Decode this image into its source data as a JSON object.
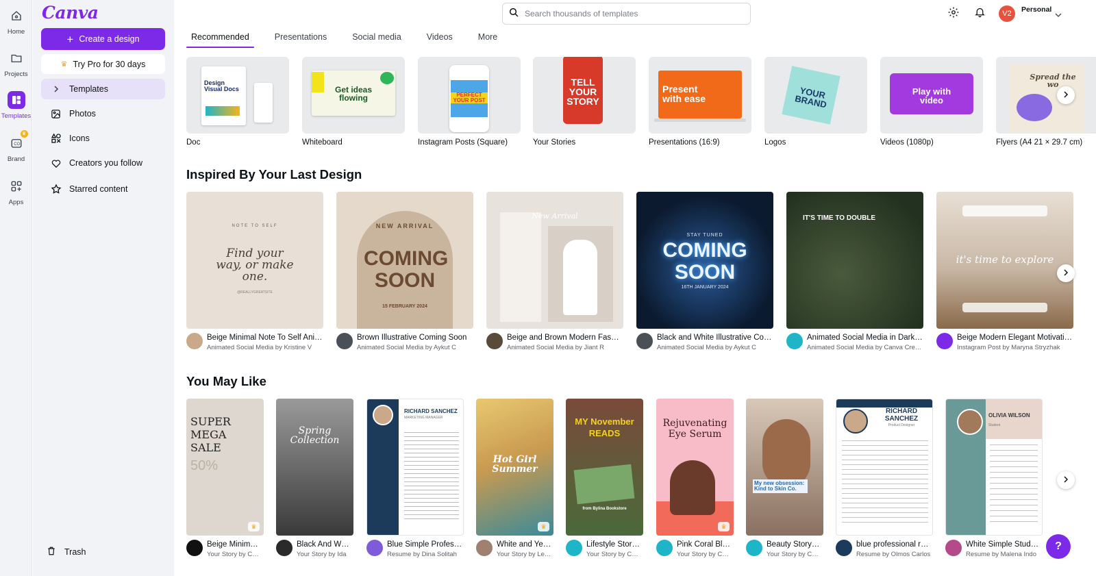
{
  "app": {
    "logo": "Canva"
  },
  "rail": [
    {
      "label": "Home",
      "icon": "home-icon"
    },
    {
      "label": "Projects",
      "icon": "folder-icon"
    },
    {
      "label": "Templates",
      "icon": "templates-icon"
    },
    {
      "label": "Brand",
      "icon": "brand-icon"
    },
    {
      "label": "Apps",
      "icon": "apps-icon"
    }
  ],
  "sidebar": {
    "create_label": "Create a design",
    "pro_label": "Try Pro for 30 days",
    "items": [
      {
        "label": "Templates",
        "icon": "chevron-right-icon"
      },
      {
        "label": "Photos",
        "icon": "photo-icon"
      },
      {
        "label": "Icons",
        "icon": "shapes-icon"
      },
      {
        "label": "Creators you follow",
        "icon": "heart-icon"
      },
      {
        "label": "Starred content",
        "icon": "star-icon"
      }
    ],
    "trash_label": "Trash"
  },
  "header": {
    "search_placeholder": "Search thousands of templates",
    "avatar_initials": "V2",
    "account_label": "Personal"
  },
  "tabs": [
    "Recommended",
    "Presentations",
    "Social media",
    "Videos",
    "More"
  ],
  "categories": [
    {
      "label": "Doc",
      "thumb_text": "Design Visual Docs"
    },
    {
      "label": "Whiteboard",
      "thumb_text": "Get ideas flowing"
    },
    {
      "label": "Instagram Posts (Square)",
      "thumb_text": "PERFECT YOUR POST"
    },
    {
      "label": "Your Stories",
      "thumb_text": "TELL YOUR STORY"
    },
    {
      "label": "Presentations (16:9)",
      "thumb_text": "Present with ease"
    },
    {
      "label": "Logos",
      "thumb_text": "YOUR BRAND"
    },
    {
      "label": "Videos (1080p)",
      "thumb_text": "Play with video"
    },
    {
      "label": "Flyers (A4 21 × 29.7 cm)",
      "thumb_text": "Spread the wo"
    }
  ],
  "inspired": {
    "title": "Inspired By Your Last Design",
    "cards": [
      {
        "title": "Beige Minimal Note To Self Animated Social Media",
        "sub": "Animated Social Media by Kristine V",
        "thumb_top": "NOTE TO SELF",
        "thumb_main": "Find your way, or make one.",
        "thumb_bottom": "@REALLYGREATSITE",
        "bg": "#e8e0d6",
        "av": "#c9a98a"
      },
      {
        "title": "Brown Illustrative Coming Soon",
        "sub": "Animated Social Media by Aykut C",
        "thumb_top": "NEW ARRIVAL",
        "thumb_main": "COMING SOON",
        "thumb_bottom": "15 FEBRUARY 2024",
        "bg": "#e5d9cc",
        "av": "#4a5058"
      },
      {
        "title": "Beige and Brown Modern Fashion",
        "sub": "Animated Social Media by Jiant R",
        "thumb_top": "New Arrival",
        "thumb_main": "",
        "thumb_bottom": "",
        "bg": "#e8e2dc",
        "av": "#5a4a3a"
      },
      {
        "title": "Black and White Illustrative Coming Soon",
        "sub": "Animated Social Media by Aykut C",
        "thumb_top": "STAY TUNED",
        "thumb_main": "COMING SOON",
        "thumb_bottom": "16TH JANUARY 2024",
        "bg": "#0b1a2e",
        "av": "#4a5058"
      },
      {
        "title": "Animated Social Media in Dark Green",
        "sub": "Animated Social Media by Canva Creative Studio",
        "thumb_top": "IT'S TIME TO DOUBLE",
        "thumb_main": "",
        "thumb_bottom": "",
        "bg": "#2f3e2c",
        "av": "#1fb5c8"
      },
      {
        "title": "Beige Modern Elegant Motivational",
        "sub": "Instagram Post by Maryna Stryzhak",
        "thumb_top": "",
        "thumb_main": "it's time to explore",
        "thumb_bottom": "",
        "bg": "#c9b8a6",
        "av": "#7d2ae8"
      }
    ]
  },
  "youmaylike": {
    "title": "You May Like",
    "cards": [
      {
        "title": "Beige Minimal Sale",
        "sub": "Your Story by Contrast Corp",
        "thumb_main": "SUPER MEGA SALE",
        "thumb_sub": "50%",
        "bg": "#ddd7cf",
        "av": "#111111"
      },
      {
        "title": "Black And White Spring Collection",
        "sub": "Your Story by Ida",
        "thumb_main": "Spring Collection",
        "thumb_sub": "",
        "bg": "#4a4a4a",
        "av": "#2a2a2a"
      },
      {
        "title": "Blue Simple Professional Resume",
        "sub": "Resume by Dina Solitah",
        "thumb_main": "RICHARD SANCHEZ",
        "thumb_sub": "MARKETING MANAGER",
        "bg": "#1c3a5a",
        "av": "#7e5bd8"
      },
      {
        "title": "White and Yellow Hot Girl Summer",
        "sub": "Your Story by Leah",
        "thumb_main": "Hot Girl Summer",
        "thumb_sub": "",
        "bg": "#c9a55a",
        "av": "#a08070"
      },
      {
        "title": "Lifestyle Story My November Reads",
        "sub": "Your Story by Canva",
        "thumb_main": "MY November READS",
        "thumb_sub": "from Bylina Bookstore",
        "bg": "#7a4a3a",
        "av": "#1fb5c8"
      },
      {
        "title": "Pink Coral Blue Rejuvenating Eye Serum",
        "sub": "Your Story by Canva",
        "thumb_main": "Rejuvenating Eye Serum",
        "thumb_sub": "",
        "bg": "#f7bcc7",
        "av": "#1fb5c8"
      },
      {
        "title": "Beauty Story My New Obsession",
        "sub": "Your Story by Canva",
        "thumb_main": "My new obsession: Kind to Skin Co.",
        "thumb_sub": "",
        "bg": "#b4a698",
        "av": "#1fb5c8"
      },
      {
        "title": "blue professional resume",
        "sub": "Resume by Olmos Carlos",
        "thumb_main": "RICHARD SANCHEZ",
        "thumb_sub": "Product Designer",
        "bg": "#ffffff",
        "av": "#1c3a5a"
      },
      {
        "title": "White Simple Student Resume",
        "sub": "Resume by Malena Indo",
        "thumb_main": "OLIVIA WILSON",
        "thumb_sub": "Student",
        "bg": "#e8d5cc",
        "av": "#b44a8a"
      }
    ]
  },
  "colors": {
    "accent": "#7d2ae8",
    "sidebar_bg": "#f2f3f6",
    "active_bg": "#e6e0f9",
    "avatar_bg": "#e8523c"
  },
  "help_label": "?"
}
